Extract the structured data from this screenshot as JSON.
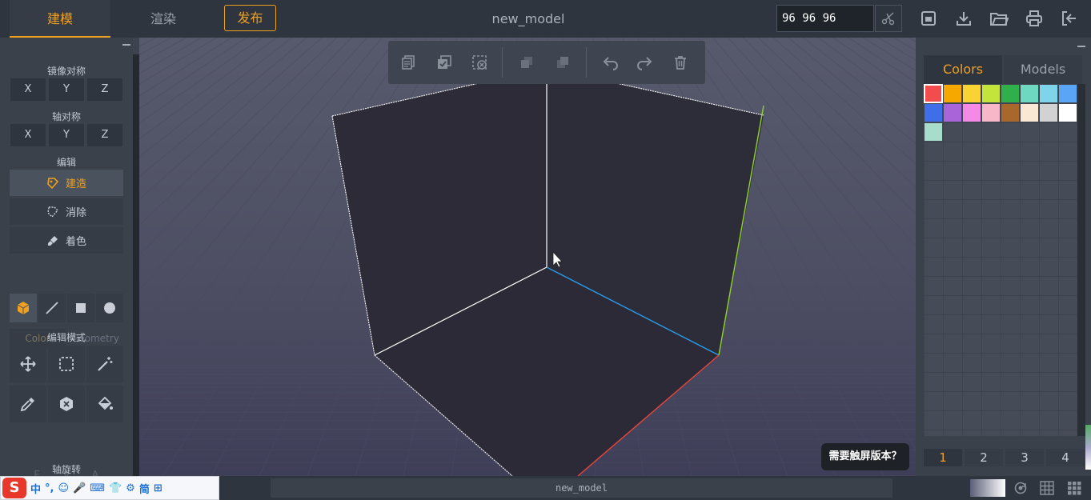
{
  "header": {
    "tabs": [
      {
        "label": "建模",
        "active": true
      },
      {
        "label": "渲染",
        "active": false
      }
    ],
    "publish_label": "发布",
    "document_title": "new_model",
    "dimensions_value": "96 96 96",
    "tool_icons": [
      "scissors-icon",
      "save-icon",
      "download-icon",
      "open-folder-icon",
      "print-icon",
      "exit-icon"
    ]
  },
  "left_panel": {
    "mirror_title": "镜像对称",
    "mirror_axes": [
      "X",
      "Y",
      "Z"
    ],
    "axis_sym_title": "轴对称",
    "axis_sym_axes": [
      "X",
      "Y",
      "Z"
    ],
    "edit_title": "编辑",
    "edit_actions": [
      {
        "label": "建造",
        "icon": "build-icon",
        "active": true
      },
      {
        "label": "消除",
        "icon": "erase-icon",
        "active": false
      },
      {
        "label": "着色",
        "icon": "paint-brush-icon",
        "active": false
      }
    ],
    "shapes": [
      "cube-icon",
      "line-icon",
      "square-icon",
      "circle-icon"
    ],
    "subtabs": [
      "Color",
      "Geometry"
    ],
    "edit_mode_title": "编辑模式",
    "edit_modes": [
      "move-icon",
      "select-rect-icon",
      "magic-wand-icon",
      "eyedropper-icon",
      "hex-remove-icon",
      "fill-bucket-icon"
    ],
    "fva_labels": [
      "F",
      "V",
      "A"
    ],
    "axis_rotate_title": "轴旋转"
  },
  "viewport_toolbar": [
    "copy-icon",
    "select-all-icon",
    "deselect-icon",
    "merge-down-icon",
    "merge-up-icon",
    "undo-icon",
    "redo-icon",
    "trash-icon"
  ],
  "viewport": {
    "touch_tip": "需要触屏版本？",
    "axis_colors": {
      "x": "#e8453c",
      "y": "#8fd32a",
      "z": "#2a9be8"
    }
  },
  "right_panel": {
    "tabs": [
      {
        "label": "Colors",
        "active": true
      },
      {
        "label": "Models",
        "active": false
      }
    ],
    "palette": [
      "#f24c4c",
      "#f7a800",
      "#f9d234",
      "#c3e43a",
      "#2fb04a",
      "#6fd8c1",
      "#7ed4ea",
      "#5aa5f5",
      "#3f6fe8",
      "#a864d8",
      "#f58ae6",
      "#f7b7c9",
      "#a8672b",
      "#fbe8d4",
      "#d2d2d2",
      "#ffffff",
      "#a8dccb"
    ],
    "selected_color": "#f24c4c",
    "pages": [
      "1",
      "2",
      "3",
      "4"
    ],
    "active_page": "1"
  },
  "bottom_bar": {
    "ime_items": [
      "中",
      "°,",
      "☺",
      "🎤",
      "⌨",
      "👕",
      "⚙",
      "简",
      "⊞"
    ],
    "status_name": "new_model",
    "right_icons": [
      "reset-view-icon",
      "grid-icon",
      "dense-grid-icon"
    ]
  }
}
